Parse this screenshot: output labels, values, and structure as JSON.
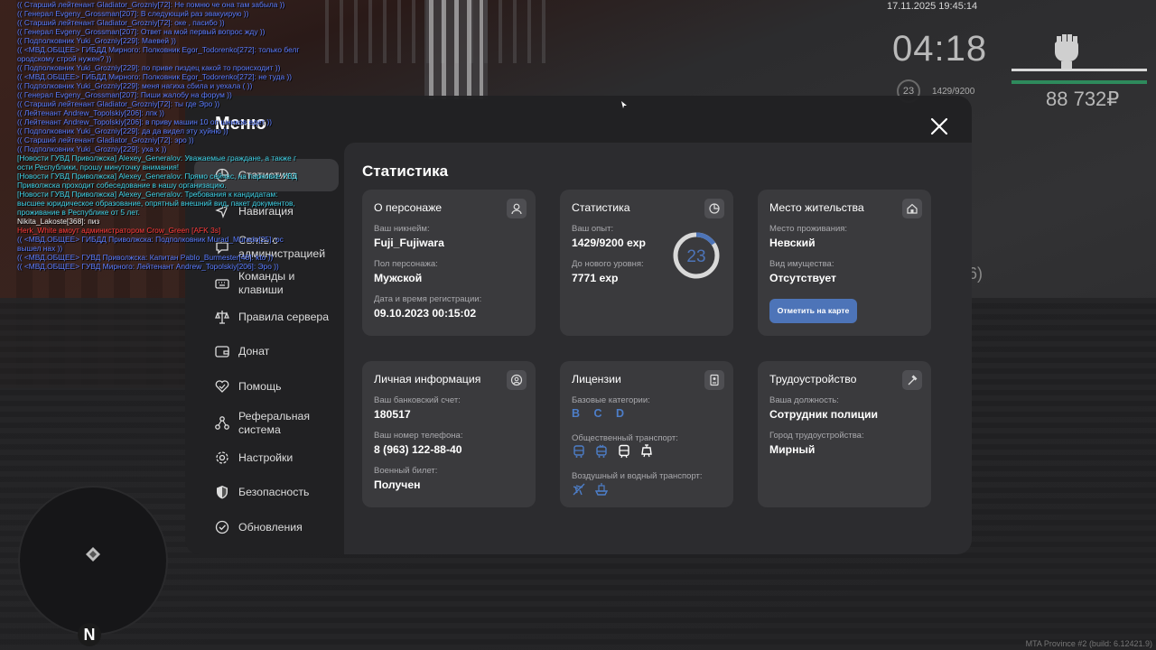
{
  "hud": {
    "datetime": "17.11.2025 19:45:14",
    "clock": "04:18",
    "money": "88 732₽",
    "level": "23",
    "exp": "1429/9200",
    "side_text": "6)",
    "build": "MTA Province #2 (build: 6.12421.9)"
  },
  "minimap": {
    "compass": "N"
  },
  "chat": [
    {
      "c": "blue",
      "t": "(( Старший лейтенант Gladiator_Grozniy[72]: Не помню че она там забыла ))"
    },
    {
      "c": "blue",
      "t": "(( Генерал Evgeny_Grossman[207]: В следующий раз эвакуирую ))"
    },
    {
      "c": "blue",
      "t": "(( Старший лейтенант Gladiator_Grozniy[72]: оке , пасибо ))"
    },
    {
      "c": "blue",
      "t": "(( Генерал Evgeny_Grossman[207]: Ответ на мой первый вопрос жду ))"
    },
    {
      "c": "blue",
      "t": "(( Подполковник Yuki_Grozniy[229]: Маевей ))"
    },
    {
      "c": "blue",
      "t": "(( <МВД.ОБЩЕЕ> ГИБДД Мирного: Полковник Egor_Todorenko[272]: только белг ородскому строй нужен? ))"
    },
    {
      "c": "blue",
      "t": "(( Подполковник Yuki_Grozniy[229]: по приве пиздец какой то происходит ))"
    },
    {
      "c": "blue",
      "t": "(( <МВД.ОБЩЕЕ> ГИБДД Мирного: Полковник Egor_Todorenko[272]: не туда ))"
    },
    {
      "c": "blue",
      "t": "(( Подполковник Yuki_Grozniy[229]: меня нагиха сбила и уехала ( ))"
    },
    {
      "c": "blue",
      "t": "(( Генерал Evgeny_Grossman[207]: Пиши жалобу на форум ))"
    },
    {
      "c": "blue",
      "t": "(( Старший лейтенант Gladiator_Grozniy[72]: ты где Эро ))"
    },
    {
      "c": "blue",
      "t": "(( Лейтенант Andrew_Topolskiy[206]: лпк ))"
    },
    {
      "c": "blue",
      "t": "(( Лейтенант Andrew_Topolskiy[206]: в приву машин 10 оп шников едет ))"
    },
    {
      "c": "blue",
      "t": "(( Подполковник Yuki_Grozniy[229]: да да видел эту хуйню ))"
    },
    {
      "c": "blue",
      "t": "(( Старший лейтенант Gladiator_Grozniy[72]: эро ))"
    },
    {
      "c": "blue",
      "t": "(( Подполковник Yuki_Grozniy[229]: уха х ))"
    },
    {
      "c": "cyan",
      "t": "[Новости ГУВД Приволжска] Alexey_Generalov: Уважаемые граждане, а также г ости Республики, прошу минуточку внимания!"
    },
    {
      "c": "cyan",
      "t": "[Новости ГУВД Приволжска] Alexey_Generalov: Прямо сейчас, на парковке УВД Приволжска проходит собеседование в нашу организацию."
    },
    {
      "c": "cyan",
      "t": "[Новости ГУВД Приволжска] Alexey_Generalov: Требования к кандидатам: высшее юридическое образование, опрятный внешний вид, пакет документов, проживание в Республике от 5 лет."
    },
    {
      "c": "white",
      "t": "Nikita_Lakoste[368]: пиз"
    },
    {
      "c": "red",
      "t": "Herk_White вмоут администратором Crow_Green [AFK 3s]"
    },
    {
      "c": "blue",
      "t": "(( <МВД.ОБЩЕЕ> ГИБДД Приволжска: Подполковник Murad_Murado[25]: ос вышел нах ))"
    },
    {
      "c": "blue",
      "t": "(( <МВД.ОБЩЕЕ> ГУВД Приволжска: Капитан Pablo_Burmester[48]: kto ))"
    },
    {
      "c": "blue",
      "t": "(( <МВД.ОБЩЕЕ> ГУВД Мирного: Лейтенант Andrew_Topolskiy[206]: Эро ))"
    }
  ],
  "menu": {
    "title": "Меню",
    "sidebar": [
      {
        "label": "Статистика",
        "icon": "pie-chart-icon",
        "active": true
      },
      {
        "label": "Навигация",
        "icon": "navigation-icon"
      },
      {
        "label": "Связь с администрацией",
        "icon": "chat-icon"
      },
      {
        "label": "Команды и клавиши",
        "icon": "keyboard-icon"
      },
      {
        "label": "Правила сервера",
        "icon": "scales-icon"
      },
      {
        "label": "Донат",
        "icon": "wallet-icon"
      },
      {
        "label": "Помощь",
        "icon": "heart-handshake-icon"
      },
      {
        "label": "Реферальная система",
        "icon": "referral-icon"
      },
      {
        "label": "Настройки",
        "icon": "gear-icon"
      },
      {
        "label": "Безопасность",
        "icon": "shield-icon"
      },
      {
        "label": "Обновления",
        "icon": "update-icon"
      }
    ],
    "content_title": "Статистика",
    "character": {
      "title": "О персонаже",
      "nick_label": "Ваш никнейм:",
      "nick": "Fuji_Fujiwara",
      "gender_label": "Пол персонажа:",
      "gender": "Мужской",
      "reg_label": "Дата и время регистрации:",
      "reg": "09.10.2023 00:15:02"
    },
    "stats": {
      "title": "Статистика",
      "exp_label": "Ваш опыт:",
      "exp": "1429/9200 exp",
      "next_label": "До нового уровня:",
      "next": "7771 exp",
      "level": "23",
      "progress": 0.155
    },
    "residence": {
      "title": "Место жительства",
      "place_label": "Место проживания:",
      "place": "Невский",
      "property_label": "Вид имущества:",
      "property": "Отсутствует",
      "button": "Отметить на карте"
    },
    "personal": {
      "title": "Личная информация",
      "bank_label": "Ваш банковский счет:",
      "bank": "180517",
      "phone_label": "Ваш номер телефона:",
      "phone": "8 (963) 122-88-40",
      "military_label": "Военный билет:",
      "military": "Получен"
    },
    "licenses": {
      "title": "Лицензии",
      "base_label": "Базовые категории:",
      "base": "B C D",
      "public_label": "Общественный транспорт:",
      "air_label": "Воздушный и водный транспорт:"
    },
    "job": {
      "title": "Трудоустройство",
      "position_label": "Ваша должность:",
      "position": "Сотрудник полиции",
      "city_label": "Город трудоустройства:",
      "city": "Мирный"
    }
  }
}
